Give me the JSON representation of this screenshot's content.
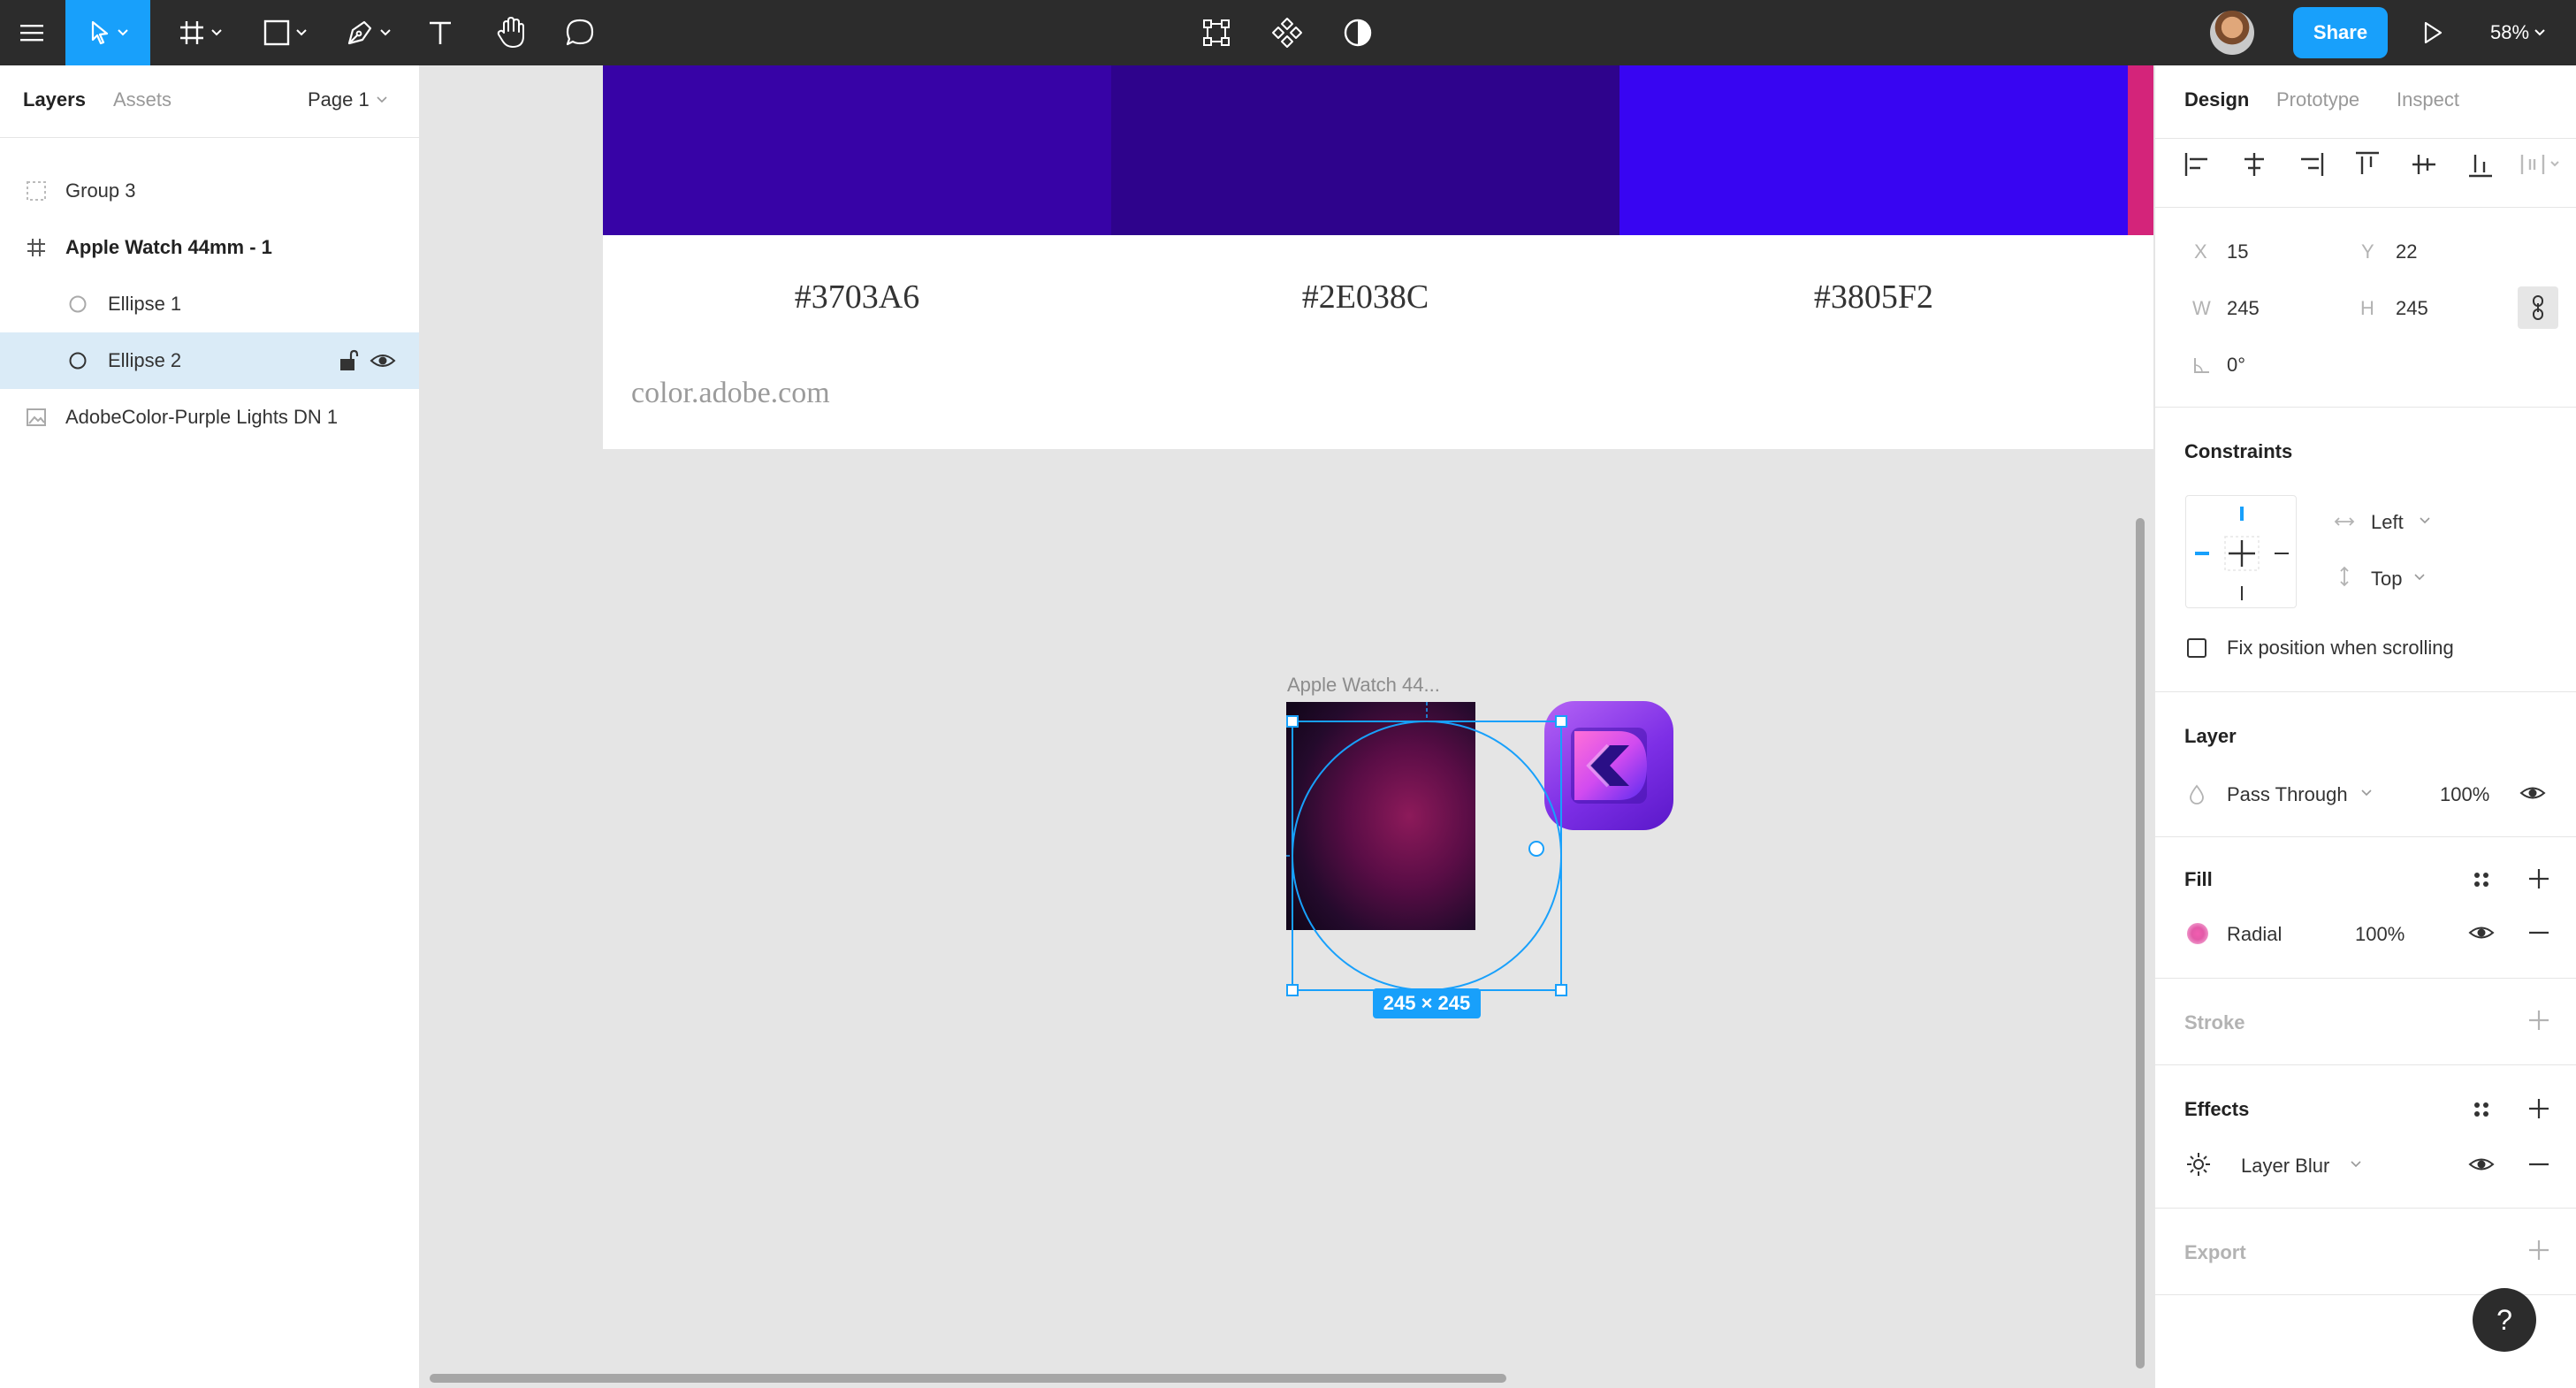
{
  "toolbar": {
    "tools": [
      {
        "icon": "menu-icon"
      },
      {
        "icon": "move-tool-icon",
        "active": true
      },
      {
        "icon": "frame-tool-icon"
      },
      {
        "icon": "rectangle-tool-icon"
      },
      {
        "icon": "pen-tool-icon"
      },
      {
        "icon": "text-tool-icon"
      },
      {
        "icon": "hand-tool-icon"
      },
      {
        "icon": "comment-tool-icon"
      }
    ],
    "center_tools": [
      "edit-object-icon",
      "component-icon",
      "mask-icon"
    ],
    "share_label": "Share",
    "zoom_label": "58%",
    "accent_color": "#18a0fb"
  },
  "left_panel": {
    "tabs": [
      {
        "label": "Layers",
        "active": true
      },
      {
        "label": "Assets",
        "active": false
      }
    ],
    "page_selector": "Page 1",
    "layers": [
      {
        "name": "Group 3",
        "icon": "group-icon",
        "bold": false,
        "selected": false
      },
      {
        "name": "Apple Watch 44mm - 1",
        "icon": "frame-icon",
        "bold": true,
        "selected": false
      },
      {
        "name": "Ellipse 1",
        "icon": "ellipse-icon",
        "bold": false,
        "selected": false
      },
      {
        "name": "Ellipse 2",
        "icon": "ellipse-icon",
        "bold": false,
        "selected": true
      },
      {
        "name": "AdobeColor-Purple Lights DN 1",
        "icon": "image-icon",
        "bold": false,
        "selected": false
      }
    ]
  },
  "canvas": {
    "swatches": [
      {
        "hex_label": "#3703A6",
        "color": "#3703A6"
      },
      {
        "hex_label": "#2E038C",
        "color": "#2E038C"
      },
      {
        "hex_label": "#3805F2",
        "color": "#3805F2"
      }
    ],
    "edge_swatch_color": "#d4247a",
    "source_url": "color.adobe.com",
    "frame_title": "Apple Watch 44...",
    "size_badge": "245 × 245"
  },
  "right_panel": {
    "tabs": [
      {
        "label": "Design",
        "active": true
      },
      {
        "label": "Prototype",
        "active": false
      },
      {
        "label": "Inspect",
        "active": false
      }
    ],
    "transform": {
      "x_label": "X",
      "x": "15",
      "y_label": "Y",
      "y": "22",
      "w_label": "W",
      "w": "245",
      "h_label": "H",
      "h": "245",
      "rotation": "0°"
    },
    "constraints": {
      "title": "Constraints",
      "horizontal": "Left",
      "vertical": "Top",
      "fix_position_label": "Fix position when scrolling"
    },
    "layer": {
      "title": "Layer",
      "blend_mode": "Pass Through",
      "opacity": "100%"
    },
    "fill": {
      "title": "Fill",
      "type": "Radial",
      "opacity": "100%"
    },
    "stroke": {
      "title": "Stroke"
    },
    "effects": {
      "title": "Effects",
      "effect": "Layer Blur"
    },
    "export": {
      "title": "Export"
    },
    "help_label": "?"
  }
}
